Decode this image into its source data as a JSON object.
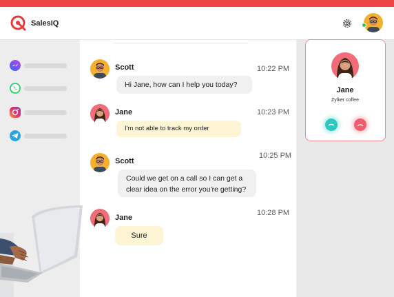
{
  "header": {
    "brand": "SalesIQ",
    "icons": [
      "salesiq-logo-icon",
      "gear-icon",
      "user-avatar"
    ]
  },
  "sidebar": {
    "channels": [
      {
        "icon": "messenger-icon",
        "color": "#6f4cf5"
      },
      {
        "icon": "whatsapp-icon",
        "color": "#25d366"
      },
      {
        "icon": "instagram-icon",
        "color": "#e1306c"
      },
      {
        "icon": "telegram-icon",
        "color": "#2aa3e0"
      }
    ]
  },
  "chat": {
    "messages": [
      {
        "sender": "Scott",
        "time": "10:22 PM",
        "text": "Hi Jane, how can I help you today?"
      },
      {
        "sender": "Jane",
        "time": "10:23 PM",
        "text": "I'm not able to track my order"
      },
      {
        "sender": "Scott",
        "time": "10:25 PM",
        "text_line1": "Could we get on a call so I can get a",
        "text_line2": "clear idea on the error you're getting?"
      },
      {
        "sender": "Jane",
        "time": "10:28 PM",
        "text": "Sure"
      }
    ]
  },
  "call": {
    "name": "Jane",
    "company": "Zylker coffee",
    "accept_color": "#2cc9c0",
    "decline_color": "#f25c6b"
  },
  "colors": {
    "accent": "#ef4444",
    "bubble_agent": "#f0f0f1",
    "bubble_visitor": "#fdf4d4"
  }
}
